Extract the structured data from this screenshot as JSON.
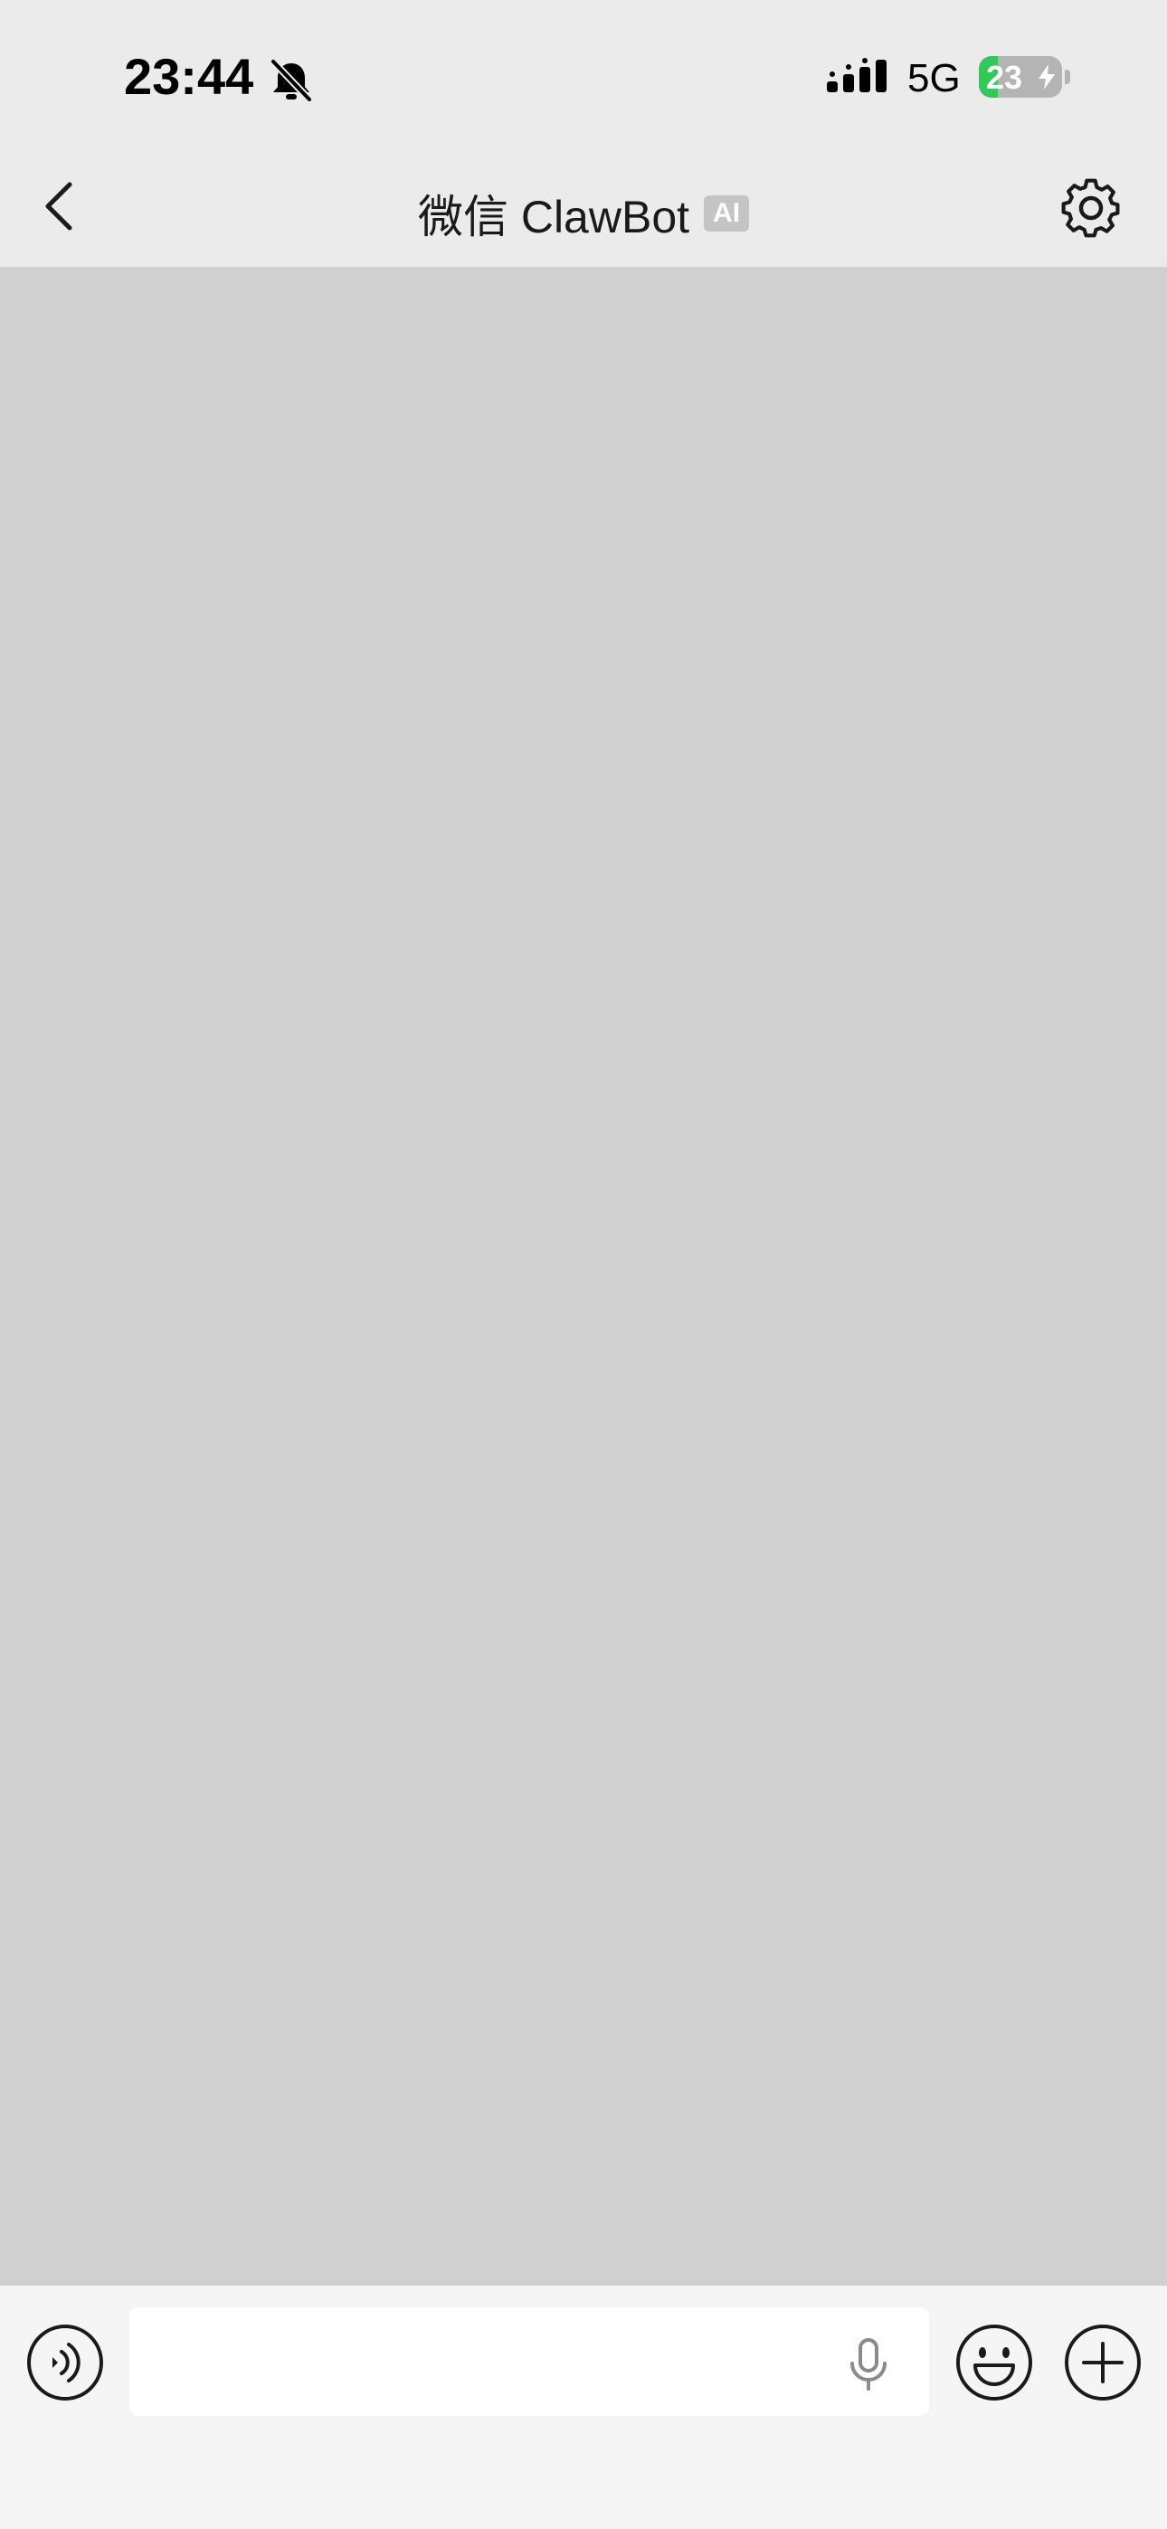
{
  "status_bar": {
    "time": "23:44",
    "muted_icon": "bell-slash-icon",
    "signal_icon": "cellular-signal-icon",
    "network": "5G",
    "battery_level": "23",
    "battery_charging_icon": "bolt-icon",
    "battery_fill_percent": 23,
    "battery_fill_color": "#34c759"
  },
  "nav": {
    "back_icon": "chevron-left-icon",
    "title": "微信 ClawBot",
    "badge": "AI",
    "settings_icon": "gear-icon"
  },
  "chat": {
    "background_color": "#d0d0d0"
  },
  "input_bar": {
    "voice_icon": "voice-input-icon",
    "message_value": "",
    "mic_icon": "microphone-icon",
    "emoji_icon": "emoji-smile-icon",
    "more_icon": "plus-circle-icon"
  }
}
